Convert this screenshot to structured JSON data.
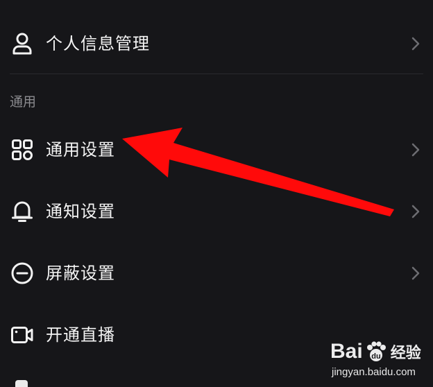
{
  "menu": {
    "profile": {
      "label": "个人信息管理",
      "icon": "user-icon"
    },
    "section_general": "通用",
    "items": [
      {
        "label": "通用设置",
        "icon": "grid-icon"
      },
      {
        "label": "通知设置",
        "icon": "bell-icon"
      },
      {
        "label": "屏蔽设置",
        "icon": "minus-circle-icon"
      },
      {
        "label": "开通直播",
        "icon": "video-camera-icon"
      }
    ]
  },
  "annotation": {
    "type": "red-arrow",
    "points_to": "通用设置",
    "color": "#ff0a0a"
  },
  "watermark": {
    "brand_a": "Bai",
    "brand_b": "du",
    "brand_c": "经验",
    "url": "jingyan.baidu.com"
  },
  "colors": {
    "background": "#161619",
    "text": "#f4f4f4",
    "secondary_text": "#8c8c90",
    "chevron": "#6d6d72"
  }
}
